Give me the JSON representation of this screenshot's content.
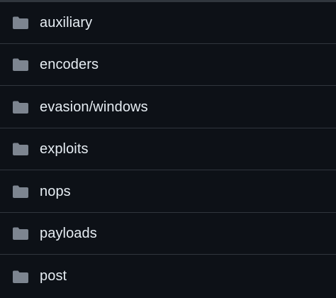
{
  "icon_color": "#7d8590",
  "text_color": "#e6edf3",
  "background_color": "#0d1117",
  "divider_color": "#30363d",
  "folders": [
    {
      "name": "auxiliary",
      "icon": "folder-icon"
    },
    {
      "name": "encoders",
      "icon": "folder-icon"
    },
    {
      "name": "evasion/windows",
      "icon": "folder-icon"
    },
    {
      "name": "exploits",
      "icon": "folder-icon"
    },
    {
      "name": "nops",
      "icon": "folder-icon"
    },
    {
      "name": "payloads",
      "icon": "folder-icon"
    },
    {
      "name": "post",
      "icon": "folder-icon"
    }
  ]
}
